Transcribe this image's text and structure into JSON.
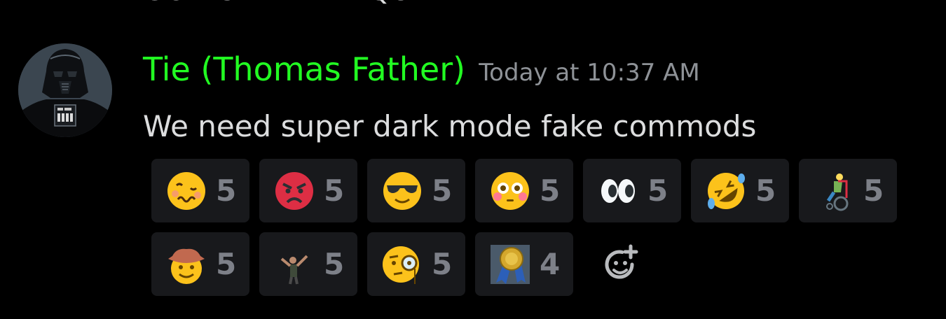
{
  "previous_message": {
    "text": "GOD SAVE THE QUEEN"
  },
  "message": {
    "username": "Tie (Thomas Father)",
    "username_color": "#22ff22",
    "timestamp": "Today at 10:37 AM",
    "text": "We need super dark mode fake commods"
  },
  "reactions": [
    {
      "icon": "woozy-face-icon",
      "count": "5"
    },
    {
      "icon": "angry-face-icon",
      "count": "5"
    },
    {
      "icon": "sunglasses-face-icon",
      "count": "5"
    },
    {
      "icon": "flushed-face-icon",
      "count": "5"
    },
    {
      "icon": "eyes-icon",
      "count": "5"
    },
    {
      "icon": "rofl-face-icon",
      "count": "5"
    },
    {
      "icon": "person-wheelchair-icon",
      "count": "5"
    },
    {
      "icon": "cowboy-face-icon",
      "count": "5"
    },
    {
      "icon": "dab-person-icon",
      "count": "5"
    },
    {
      "icon": "monocle-face-icon",
      "count": "5"
    },
    {
      "icon": "medal-icon",
      "count": "4"
    }
  ],
  "add_reaction_icon": "add-reaction-icon"
}
